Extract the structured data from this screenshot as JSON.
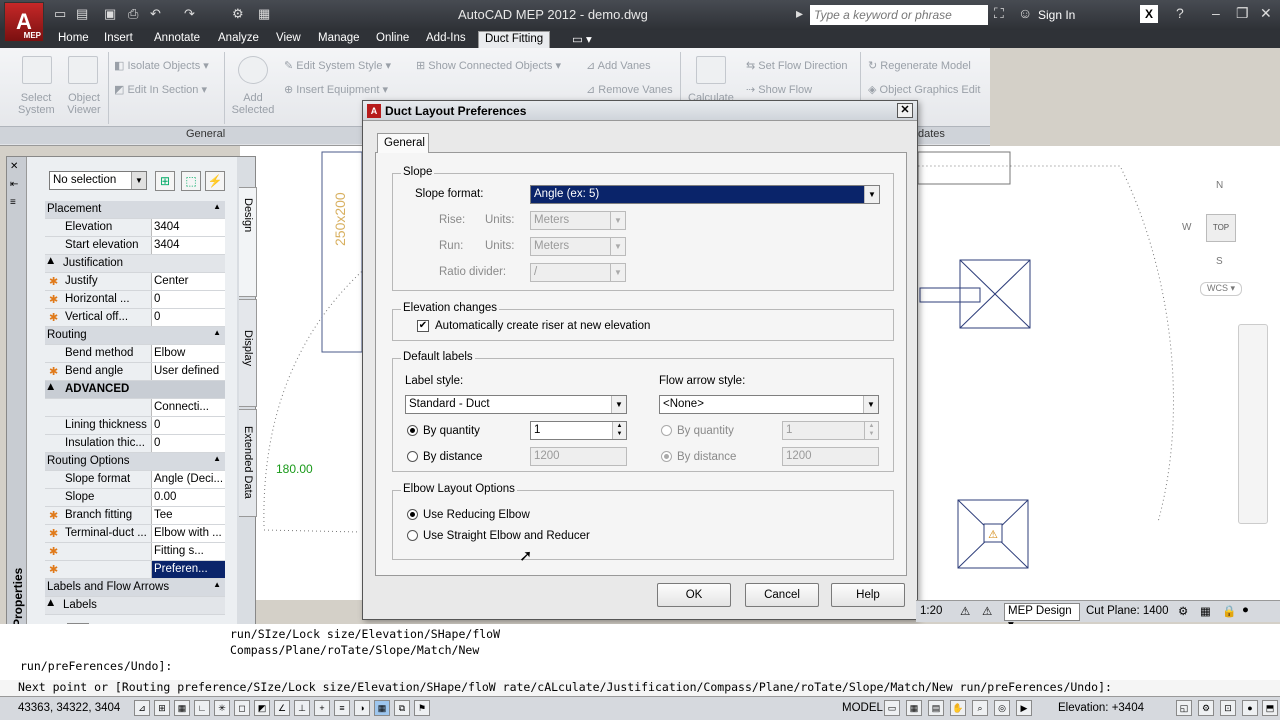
{
  "app": {
    "logo_letter": "A",
    "logo_sub": "MEP",
    "title": "AutoCAD MEP 2012 - demo.dwg",
    "search_placeholder": "Type a keyword or phrase",
    "sign_in": "Sign In"
  },
  "ribbon_tabs": [
    "Home",
    "Insert",
    "Annotate",
    "Analyze",
    "View",
    "Manage",
    "Online",
    "Add-Ins",
    "Duct Fitting"
  ],
  "active_tab": "Duct Fitting",
  "ribbon": {
    "select_system": "Select System",
    "object_viewer": "Object Viewer",
    "isolate_objects": "Isolate Objects",
    "edit_in_section": "Edit In Section",
    "add_selected": "Add Selected",
    "edit_system_style": "Edit System Style",
    "insert_equipment": "Insert Equipment",
    "show_connected": "Show Connected Objects",
    "add_vanes": "Add Vanes",
    "remove_vanes": "Remove Vanes",
    "calculate": "Calculate",
    "set_flow_direction": "Set Flow Direction",
    "show_flow": "Show Flow",
    "regenerate_model": "Regenerate Model",
    "object_graphics_edit": "Object Graphics Edit",
    "panel_general": "General",
    "panel_updates": "dates"
  },
  "palette": {
    "selection": "No selection",
    "title": "Properties",
    "tabs": [
      "Design",
      "Display",
      "Extended Data"
    ],
    "rows": [
      {
        "type": "cat",
        "name": "Placement"
      },
      {
        "type": "prop",
        "name": "Elevation",
        "value": "3404"
      },
      {
        "type": "prop",
        "name": "Start elevation",
        "value": "3404"
      },
      {
        "type": "sub",
        "name": "Justification"
      },
      {
        "type": "prop",
        "star": true,
        "name": "Justify",
        "value": "Center"
      },
      {
        "type": "prop",
        "star": true,
        "name": "Horizontal ...",
        "value": "0"
      },
      {
        "type": "prop",
        "star": true,
        "name": "Vertical off...",
        "value": "0"
      },
      {
        "type": "cat",
        "name": "Routing"
      },
      {
        "type": "prop",
        "name": "Bend method",
        "value": "Elbow"
      },
      {
        "type": "prop",
        "star": true,
        "name": "Bend angle",
        "value": "User defined"
      },
      {
        "type": "adv",
        "name": "ADVANCED"
      },
      {
        "type": "prop",
        "name": "",
        "value": "Connecti..."
      },
      {
        "type": "prop",
        "name": "Lining thickness",
        "value": "0"
      },
      {
        "type": "prop",
        "name": "Insulation thic...",
        "value": "0"
      },
      {
        "type": "cat",
        "name": "Routing Options"
      },
      {
        "type": "prop",
        "name": "Slope format",
        "value": "Angle (Deci..."
      },
      {
        "type": "prop",
        "name": "Slope",
        "value": "0.00"
      },
      {
        "type": "prop",
        "star": true,
        "name": "Branch fitting",
        "value": "Tee"
      },
      {
        "type": "prop",
        "star": true,
        "name": "Terminal-duct ...",
        "value": "Elbow with ..."
      },
      {
        "type": "prop",
        "star": true,
        "name": "",
        "value": "Fitting s..."
      },
      {
        "type": "sel",
        "star": true,
        "name": "",
        "value": "Preferen..."
      },
      {
        "type": "cat",
        "name": "Labels and Flow Arrows"
      },
      {
        "type": "sub",
        "name": "Labels"
      }
    ]
  },
  "dialog": {
    "title": "Duct Layout Preferences",
    "tab": "General",
    "slope": {
      "group": "Slope",
      "format_label": "Slope format:",
      "format_value": "Angle (ex: 5)",
      "rise_label": "Rise:",
      "run_label": "Run:",
      "units_label": "Units:",
      "units_value": "Meters",
      "ratio_label": "Ratio divider:",
      "ratio_value": "/"
    },
    "elevation": {
      "group": "Elevation changes",
      "auto_riser": "Automatically create riser at new elevation"
    },
    "labels": {
      "group": "Default labels",
      "label_style": "Label style:",
      "label_style_value": "Standard - Duct",
      "flow_style": "Flow arrow style:",
      "flow_style_value": "<None>",
      "by_quantity": "By quantity",
      "by_distance": "By distance",
      "qty_value": "1",
      "dist_value": "1200"
    },
    "elbow": {
      "group": "Elbow Layout Options",
      "opt1": "Use Reducing Elbow",
      "opt2": "Use Straight Elbow and Reducer"
    },
    "buttons": {
      "ok": "OK",
      "cancel": "Cancel",
      "help": "Help"
    }
  },
  "drawing": {
    "dim_text": "250x200",
    "angle_text": "180.00",
    "compass": {
      "n": "N",
      "w": "W",
      "s": "S",
      "top": "TOP",
      "wcs": "WCS"
    }
  },
  "command": {
    "line1": "run/SIze/Lock size/Elevation/SHape/floW",
    "line2": "Compass/Plane/roTate/Slope/Match/New",
    "line3": "run/preFerences/Undo]:",
    "input": "Next point or [Routing preference/SIze/Lock size/Elevation/SHape/floW rate/cALculate/Justification/Compass/Plane/roTate/Slope/Match/New run/preFerences/Undo]:"
  },
  "status": {
    "coords": "43363, 34322, 3404",
    "model": "MODEL",
    "elevation": "Elevation: +3404",
    "scale": "1:20",
    "config": "MEP Design",
    "cut_plane": "Cut Plane:  1400"
  }
}
